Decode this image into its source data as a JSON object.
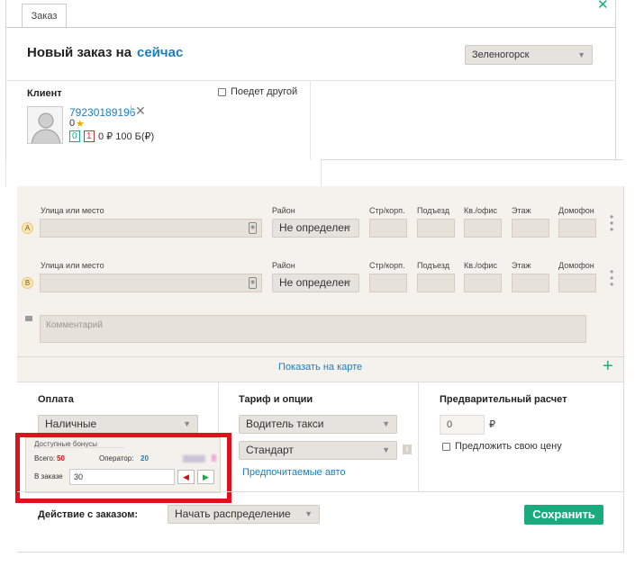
{
  "tab": {
    "label": "Заказ"
  },
  "header": {
    "title": "Новый заказ на",
    "when_link": "сейчас",
    "city": "Зеленогорск"
  },
  "client": {
    "label": "Клиент",
    "other_rides_label": "Поедет другой",
    "phone": "79230189196",
    "rating": "0",
    "badge_green": "0",
    "badge_red": "1",
    "balance": "0 ₽  100 Б(₽)"
  },
  "addresses": {
    "col_street": "Улица или место",
    "col_district": "Район",
    "col_building": "Стр/корп.",
    "col_entrance": "Подъезд",
    "col_apartment": "Кв./офис",
    "col_floor": "Этаж",
    "col_intercom": "Домофон",
    "rows": [
      {
        "marker": "A",
        "district": "Не определен"
      },
      {
        "marker": "B",
        "district": "Не определен"
      }
    ],
    "comment_placeholder": "Комментарий",
    "map_link": "Показать на карте"
  },
  "payment": {
    "title": "Оплата",
    "method": "Наличные"
  },
  "bonuses": {
    "title": "Доступные бонусы",
    "total_label": "Всего:",
    "total_value": "50",
    "operator_label": "Оператор:",
    "operator_value": "20",
    "in_order_label": "В заказе",
    "in_order_value": "30"
  },
  "tariff": {
    "title": "Тариф и опции",
    "service": "Водитель такси",
    "tariff": "Стандарт",
    "preferred_link": "Предпочитаемые авто"
  },
  "estimate": {
    "title": "Предварительный расчет",
    "value": "0",
    "currency": "₽",
    "offer_price_label": "Предложить свою цену"
  },
  "footer": {
    "action_label": "Действие с заказом:",
    "action_value": "Начать распределение",
    "save_label": "Сохранить"
  },
  "colors": {
    "accent": "#1aab7d",
    "link": "#1a7dc0",
    "highlight": "#e0111a"
  }
}
